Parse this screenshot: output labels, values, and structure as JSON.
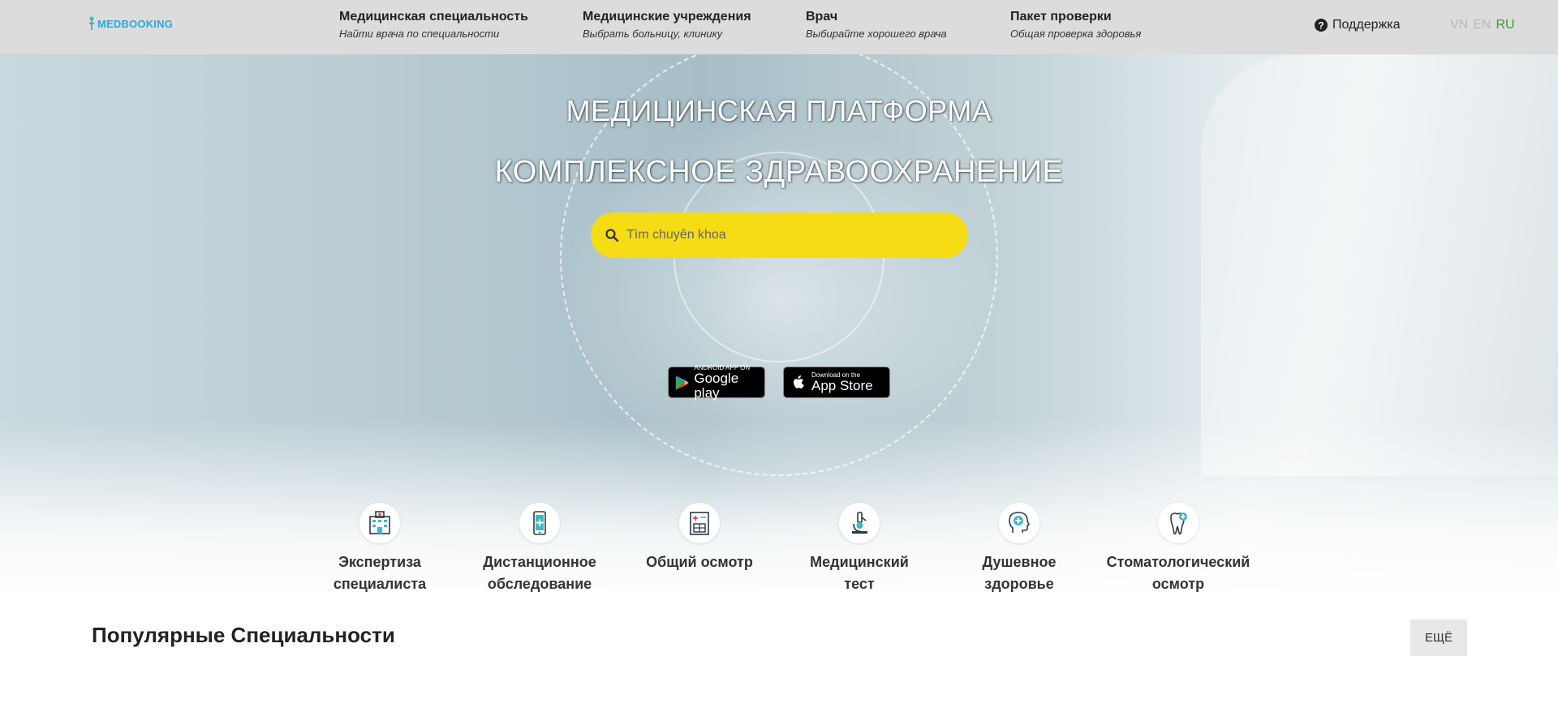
{
  "header": {
    "logo_text": "MEDBOOKING",
    "nav": [
      {
        "title": "Медицинская специальность",
        "subtitle": "Найти врача по специальности"
      },
      {
        "title": "Медицинские учреждения",
        "subtitle": "Выбрать больницу, клинику"
      },
      {
        "title": "Врач",
        "subtitle": "Выбирайте хорошего врача"
      },
      {
        "title": "Пакет проверки",
        "subtitle": "Общая проверка здоровья"
      }
    ],
    "support_label": "Поддержка",
    "languages": [
      "VN",
      "EN",
      "RU"
    ],
    "active_language": "RU"
  },
  "hero": {
    "title_line1": "МЕДИЦИНСКАЯ ПЛАТФОРМА",
    "title_line2": "КОМПЛЕКСНОЕ ЗДРАВООХРАНЕНИЕ",
    "search_placeholder": "Tìm chuyên khoa",
    "google_play": {
      "small": "ANDROID APP ON",
      "big": "Google play"
    },
    "app_store": {
      "small": "Download on the",
      "big": "App Store"
    }
  },
  "services": [
    {
      "label_line1": "Экспертиза",
      "label_line2": "специалиста",
      "icon": "hospital-icon"
    },
    {
      "label_line1": "Дистанционное",
      "label_line2": "обследование",
      "icon": "phone-medical-icon"
    },
    {
      "label_line1": "Общий осмотр",
      "label_line2": "",
      "icon": "clipboard-icon"
    },
    {
      "label_line1": "Медицинский",
      "label_line2": "тест",
      "icon": "microscope-icon"
    },
    {
      "label_line1": "Душевное",
      "label_line2": "здоровье",
      "icon": "head-mind-icon"
    },
    {
      "label_line1": "Стоматологический",
      "label_line2": "осмотр",
      "icon": "tooth-icon"
    }
  ],
  "popular": {
    "title": "Популярные Специальности",
    "more_label": "ЕЩЁ"
  },
  "colors": {
    "header_bg": "#dcdcdc",
    "search_bg": "#f5dc14",
    "logo": "#2aa8d8",
    "active_lang": "#3a9a3a"
  }
}
